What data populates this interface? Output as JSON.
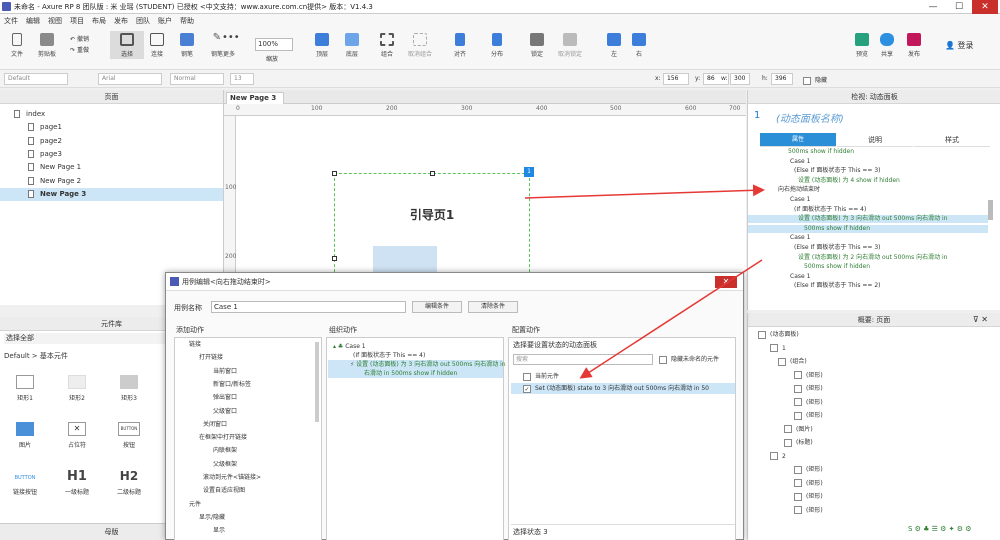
{
  "window": {
    "title": "未命名 - Axure RP 8 团队版 : 米 业瑶 (STUDENT) 已授权    <中文支持：www.axure.com.cn提供> 版本：V1.4.3",
    "min": "—",
    "max": "☐",
    "close": "✕"
  },
  "menu": [
    "文件",
    "编辑",
    "视图",
    "项目",
    "布局",
    "发布",
    "团队",
    "账户",
    "帮助"
  ],
  "toolbar": {
    "file": "文件",
    "clipboard": "剪贴板",
    "undo": "撤销",
    "redo": "重做",
    "select": "选择",
    "connect": "连接",
    "pen": "钢笔",
    "more": "更多",
    "zoom": "100%",
    "zoom_label": "缩放",
    "top": "顶层",
    "bottom": "底层",
    "group": "组合",
    "ungroup": "取消组合",
    "align": "对齐",
    "distribute": "分布",
    "lock": "锁定",
    "unlock": "取消锁定",
    "left": "左",
    "right": "右",
    "preview": "预览",
    "share": "共享",
    "publish": "发布",
    "login": "登录"
  },
  "format": {
    "style": "Default",
    "font": "Arial",
    "weight": "Normal",
    "size": "13",
    "x_label": "x:",
    "x": "156",
    "y_label": "y:",
    "y": "86",
    "w_label": "w:",
    "w": "300",
    "h_label": "h:",
    "h": "396",
    "hide": "隐藏"
  },
  "pages_panel": {
    "title": "页面",
    "items": [
      "index",
      "page1",
      "page2",
      "page3",
      "New Page 1",
      "New Page 2",
      "New Page 3"
    ]
  },
  "library": {
    "title": "元件库",
    "select": "选择全部",
    "category": "Default > 基本元件",
    "widgets": [
      "矩形1",
      "矩形2",
      "矩形3",
      "图片",
      "占位符",
      "按钮",
      "链接按钮",
      "一级标题",
      "二级标题"
    ],
    "button_text": "BUTTON",
    "h1": "H1",
    "h2": "H2"
  },
  "canvas": {
    "tab": "New Page 3",
    "panel_title": "引导页1",
    "badge": "1",
    "ruler": [
      "0",
      "100",
      "200",
      "300",
      "400",
      "500",
      "600",
      "700",
      "800"
    ],
    "vruler": [
      "100",
      "200"
    ]
  },
  "inspector": {
    "title": "检视: 动态面板",
    "number": "1",
    "name": "(动态面板名称)",
    "tabs": [
      "属性",
      "说明",
      "样式"
    ],
    "events": [
      {
        "t": "500ms show if hidden",
        "indent": 40,
        "green": true
      },
      {
        "t": "Case 1",
        "indent": 42,
        "green": false
      },
      {
        "t": "(Else If 面板状态于 This == 3)",
        "indent": 46,
        "green": false
      },
      {
        "t": "设置 (动态面板) 为 4 show if hidden",
        "indent": 50,
        "green": true
      },
      {
        "t": "向右拖动结束时",
        "indent": 30,
        "green": false
      },
      {
        "t": "Case 1",
        "indent": 42,
        "green": false
      },
      {
        "t": "(If 面板状态于 This == 4)",
        "indent": 46,
        "green": false
      },
      {
        "t": "设置 (动态面板) 为 3 向右滑动 out 500ms 向右滑动 in",
        "indent": 50,
        "green": true,
        "hl": true
      },
      {
        "t": "500ms show if hidden",
        "indent": 56,
        "green": true,
        "hl": true
      },
      {
        "t": "Case 1",
        "indent": 42,
        "green": false
      },
      {
        "t": "(Else If 面板状态于 This == 3)",
        "indent": 46,
        "green": false
      },
      {
        "t": "设置 (动态面板) 为 2 向右滑动 out 500ms 向右滑动 in",
        "indent": 50,
        "green": true
      },
      {
        "t": "500ms show if hidden",
        "indent": 56,
        "green": true
      },
      {
        "t": "Case 1",
        "indent": 42,
        "green": false
      },
      {
        "t": "(Else If 面板状态于 This == 2)",
        "indent": 46,
        "green": false
      }
    ]
  },
  "outline": {
    "title": "概要: 页面",
    "items": [
      {
        "t": "(动态面板)",
        "indent": 10
      },
      {
        "t": "1",
        "indent": 22
      },
      {
        "t": "(组合)",
        "indent": 30
      },
      {
        "t": "(矩形)",
        "indent": 46
      },
      {
        "t": "(矩形)",
        "indent": 46
      },
      {
        "t": "(矩形)",
        "indent": 46
      },
      {
        "t": "(矩形)",
        "indent": 46
      },
      {
        "t": "(图片)",
        "indent": 36
      },
      {
        "t": "(标题)",
        "indent": 36
      },
      {
        "t": "2",
        "indent": 22
      },
      {
        "t": "(矩形)",
        "indent": 46
      },
      {
        "t": "(矩形)",
        "indent": 46
      },
      {
        "t": "(矩形)",
        "indent": 46
      },
      {
        "t": "(矩形)",
        "indent": 46
      }
    ]
  },
  "masters": {
    "title": "母版"
  },
  "dialog": {
    "title": "用例编辑<向右拖动结束时>",
    "case_name_label": "用例名称",
    "case_name": "Case 1",
    "edit_cond": "编辑条件",
    "clear_cond": "清除条件",
    "add_action": "添加动作",
    "organize": "组织动作",
    "configure": "配置动作",
    "actions": [
      {
        "t": "链接",
        "indent": 14
      },
      {
        "t": "打开链接",
        "indent": 24
      },
      {
        "t": "当前窗口",
        "indent": 38
      },
      {
        "t": "新窗口/新标签",
        "indent": 38
      },
      {
        "t": "弹出窗口",
        "indent": 38
      },
      {
        "t": "父级窗口",
        "indent": 38
      },
      {
        "t": "关闭窗口",
        "indent": 28
      },
      {
        "t": "在框架中打开链接",
        "indent": 24
      },
      {
        "t": "内联框架",
        "indent": 38
      },
      {
        "t": "父级框架",
        "indent": 38
      },
      {
        "t": "滚动到元件<锚链接>",
        "indent": 28
      },
      {
        "t": "设置自适应视图",
        "indent": 28
      },
      {
        "t": "元件",
        "indent": 14
      },
      {
        "t": "显示/隐藏",
        "indent": 24
      },
      {
        "t": "显示",
        "indent": 38
      }
    ],
    "org_case": "Case 1",
    "org_cond": "(If 面板状态于 This == 4)",
    "org_action": "设置 (动态面板) 为 3 向右滑动 out 500ms 向右滑动 in",
    "org_action2": "右滑动 in 500ms show if hidden",
    "config_hdr": "选择要设置状态的动态面板",
    "search_ph": "搜索",
    "hide_unnamed": "隐藏未命名的元件",
    "current": "当前元件",
    "set_row": "Set (动态面板) state to 3 向右滑动 out 500ms 向右滑动 in 50",
    "select_state": "选择状态",
    "state_val": "3"
  },
  "colors": {
    "accent": "#2b8fd8",
    "arrow": "#e53935",
    "green": "#2e7d32"
  }
}
